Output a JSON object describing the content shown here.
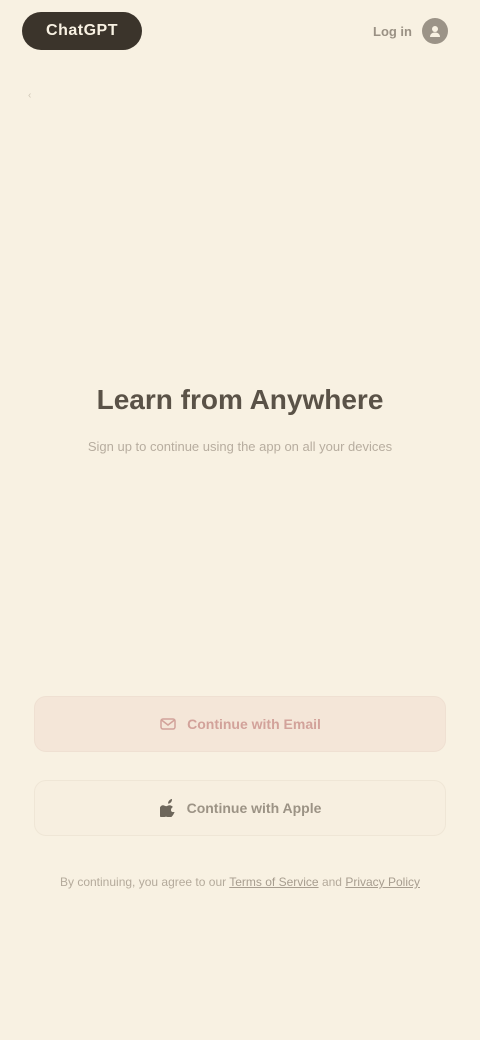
{
  "header": {
    "logo_text": "ChatGPT",
    "back_label": "‹",
    "right_link": "Log in",
    "right_icon": "user-icon"
  },
  "hero": {
    "title": "Learn from Anywhere",
    "subtitle": "Sign up to continue using the app on all your devices"
  },
  "actions": {
    "primary_label": "Continue with Email",
    "primary_icon": "mail-icon",
    "secondary_label": "Continue with Apple",
    "secondary_icon": "apple-icon"
  },
  "footer": {
    "terms_prefix": "By continuing, you agree to our",
    "terms_link": "Terms of Service",
    "terms_join": "and",
    "privacy_link": "Privacy Policy"
  },
  "colors": {
    "background": "#f8f1e2",
    "primary_text": "#3a342c",
    "accent": "#d2a29a"
  }
}
